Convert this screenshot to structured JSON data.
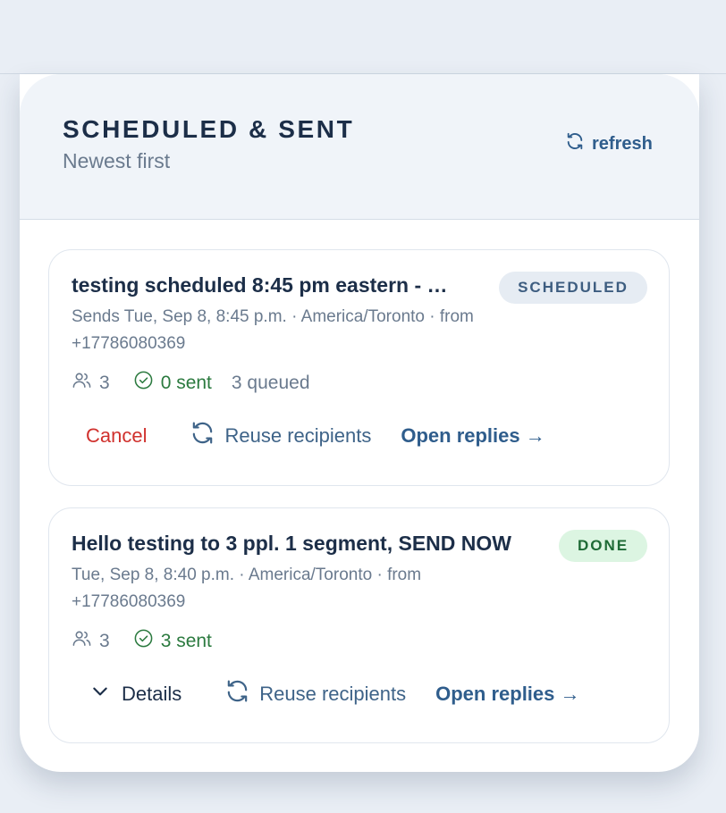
{
  "panel": {
    "title": "SCHEDULED & SENT",
    "subtitle": "Newest first",
    "refresh_label": "refresh"
  },
  "messages": [
    {
      "title": "testing scheduled 8:45 pm eastern - …",
      "status": "SCHEDULED",
      "meta": "Sends Tue, Sep 8, 8:45 p.m. · America/Toronto · from +17786080369",
      "recipients_count": "3",
      "sent_label": "0 sent",
      "queued_label": "3 queued",
      "actions": {
        "cancel": "Cancel",
        "reuse": "Reuse recipients",
        "replies": "Open replies →"
      }
    },
    {
      "title": "Hello testing to 3 ppl. 1 segment, SEND NOW",
      "status": "DONE",
      "meta": "Tue, Sep 8, 8:40 p.m. · America/Toronto · from +17786080369",
      "recipients_count": "3",
      "sent_label": "3 sent",
      "actions": {
        "details": "Details",
        "reuse": "Reuse recipients",
        "replies": "Open replies →"
      }
    }
  ],
  "icons": {
    "refresh": "refresh-icon",
    "people": "people-icon",
    "sent": "check-circle-icon",
    "reuse": "reuse-icon",
    "details": "chevron-down-icon"
  },
  "colors": {
    "accent": "#2f5d8c",
    "danger": "#d0312d",
    "success": "#2b7a3f",
    "scheduled_badge_bg": "#e6ecf3",
    "done_badge_bg": "#dcf5e2"
  }
}
